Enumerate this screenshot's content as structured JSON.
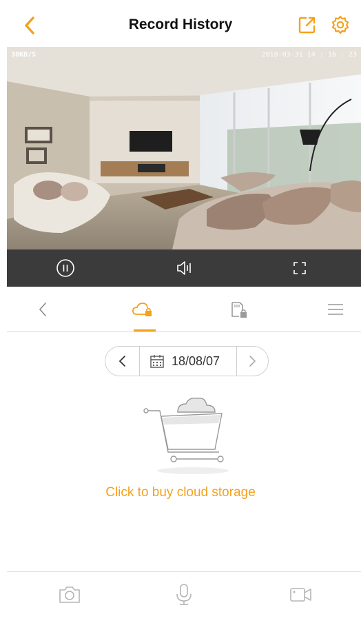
{
  "header": {
    "title": "Record History",
    "back_icon": "chevron-left-icon",
    "share_icon": "share-icon",
    "settings_icon": "gear-icon"
  },
  "video": {
    "rate": "38KB/S",
    "timestamp": "2018-03-31 14 : 16 : 23"
  },
  "video_controls": {
    "pause_icon": "pause-icon",
    "sound_icon": "speaker-icon",
    "fullscreen_icon": "fullscreen-icon"
  },
  "tabs": {
    "items": [
      "back",
      "cloud-storage",
      "sd-card",
      "menu"
    ],
    "active": "cloud-storage"
  },
  "date_selector": {
    "date": "18/08/07"
  },
  "empty_state": {
    "buy_label": "Click to buy cloud storage"
  },
  "bottom_toolbar": {
    "items": [
      "snapshot",
      "microphone",
      "record"
    ]
  },
  "colors": {
    "accent": "#f5a11c",
    "control_bar": "#3b3b3b",
    "icon_gray": "#b5b5b5"
  }
}
